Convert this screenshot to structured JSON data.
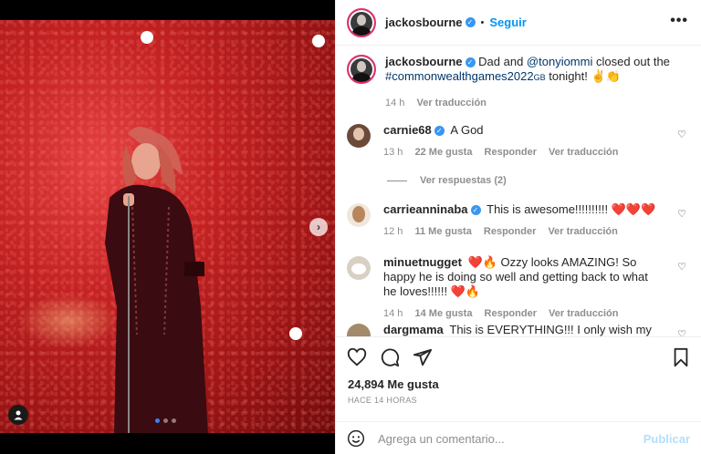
{
  "post": {
    "username": "jackosbourne",
    "follow_separator": "•",
    "follow_label": "Seguir",
    "more_label": "•••",
    "caption_prefix": "Dad and ",
    "caption_mention": "@tonyiommi",
    "caption_mid": " closed out the",
    "caption_hashtag": "#commonwealthgames2022",
    "caption_hashtag_suffix": "GB",
    "caption_end": " tonight! ",
    "caption_emoji": "✌️👏",
    "caption_time": "14 h",
    "caption_translate": "Ver traducción"
  },
  "media": {
    "slide_count": 3,
    "active_slide": 0
  },
  "comments": [
    {
      "username": "carnie68",
      "verified": true,
      "text": "A God",
      "time": "13 h",
      "likes": "22 Me gusta",
      "reply": "Responder",
      "translate": "Ver traducción",
      "avatar_color": "#6b4a3a"
    },
    {
      "username": "carrieanninaba",
      "verified": true,
      "text": "This is awesome!!!!!!!!!! ",
      "hearts": "❤️❤️❤️",
      "time": "12 h",
      "likes": "11 Me gusta",
      "reply": "Responder",
      "translate": "Ver traducción",
      "avatar_color": "#c9a47e"
    },
    {
      "username": "minuetnugget",
      "verified": false,
      "emoji_start": "❤️🔥",
      "text": " Ozzy looks AMAZING! So happy he is doing so well and getting back to what he loves!!!!!! ",
      "emoji_end": "❤️🔥",
      "time": "14 h",
      "likes": "14 Me gusta",
      "reply": "Responder",
      "translate": "Ver traducción",
      "avatar_color": "#d8d0c4"
    },
    {
      "username": "dargmama",
      "verified": false,
      "text": "This is EVERYTHING!!! I only wish my brother could",
      "avatar_color": "#a38a6a"
    }
  ],
  "replies_label": "Ver respuestas (2)",
  "likes_count": "24,894 Me gusta",
  "time_ago": "HACE 14 HORAS",
  "comment_input": {
    "placeholder": "Agrega un comentario...",
    "value": ""
  },
  "publish_label": "Publicar",
  "colors": {
    "accent_blue": "#0095f6",
    "link_blue": "#00376b",
    "muted": "#8e8e8e",
    "publish_disabled": "#b2dffc"
  }
}
